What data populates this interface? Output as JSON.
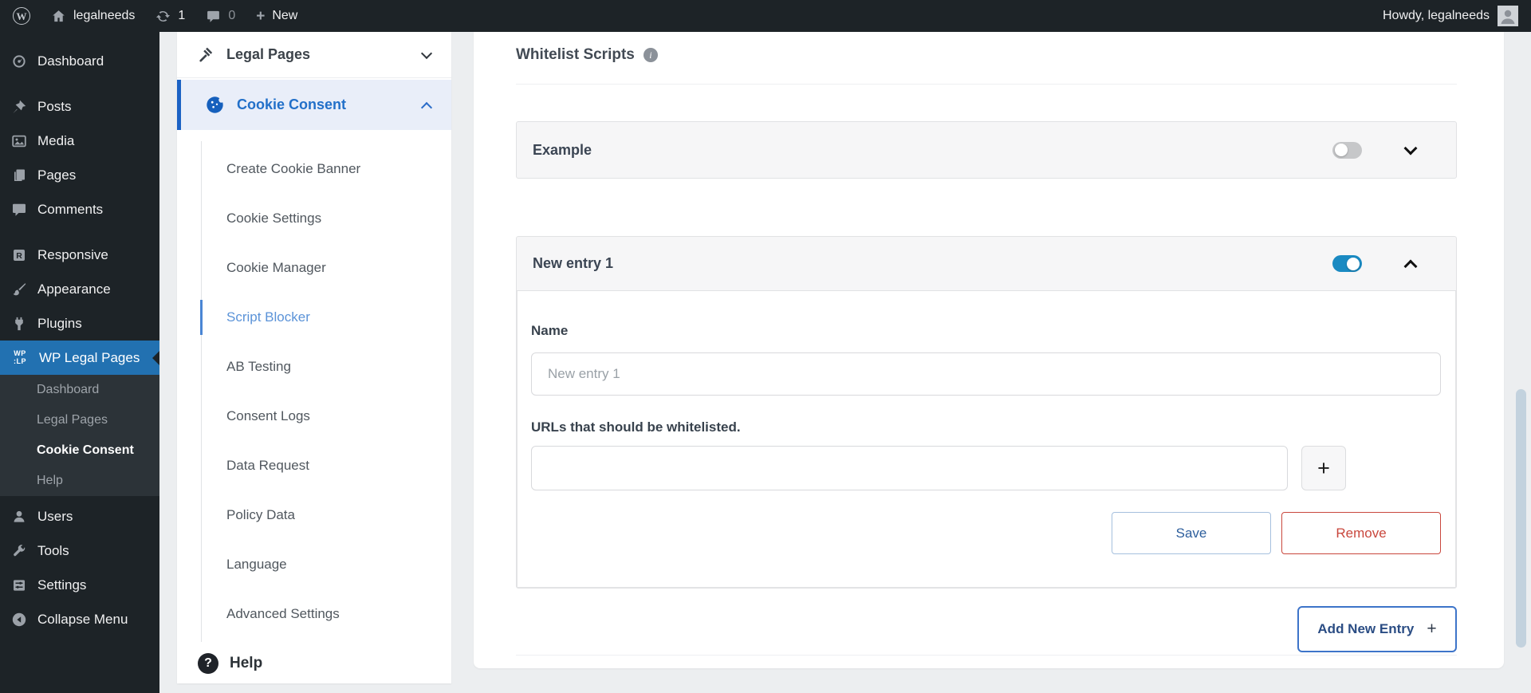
{
  "admin_bar": {
    "site_name": "legalneeds",
    "update_count": "1",
    "comment_count": "0",
    "new_label": "New",
    "howdy": "Howdy, legalneeds"
  },
  "admin_menu": {
    "items": [
      "Dashboard",
      "Posts",
      "Media",
      "Pages",
      "Comments",
      "Responsive",
      "Appearance",
      "Plugins",
      "WP Legal Pages"
    ],
    "logo_top": "WP",
    "logo_bottom": ":LP",
    "submenu": [
      "Dashboard",
      "Legal Pages",
      "Cookie Consent",
      "Help"
    ],
    "lower_items": [
      "Users",
      "Tools",
      "Settings",
      "Collapse Menu"
    ]
  },
  "plugin_sidebar": {
    "legal_pages_label": "Legal Pages",
    "cookie_consent_label": "Cookie Consent",
    "submenu": [
      "Create Cookie Banner",
      "Cookie Settings",
      "Cookie Manager",
      "Script Blocker",
      "AB Testing",
      "Consent Logs",
      "Data Request",
      "Policy Data",
      "Language",
      "Advanced Settings"
    ],
    "active_submenu_item": "Script Blocker",
    "help_label": "Help"
  },
  "main": {
    "heading": "Whitelist Scripts",
    "example_panel": {
      "title": "Example",
      "enabled": false
    },
    "entry_panel": {
      "title": "New entry 1",
      "enabled": true,
      "name_label": "Name",
      "name_placeholder": "New entry 1",
      "name_value": "",
      "urls_label": "URLs that should be whitelisted.",
      "url_value": "",
      "add_url_label": "+",
      "save_label": "Save",
      "remove_label": "Remove"
    },
    "add_new_label": "Add New Entry",
    "add_new_plus": "+"
  },
  "colors": {
    "accent_blue": "#2271b1",
    "toggle_on_blue": "#1a8ac2",
    "danger_red": "#c9473d",
    "active_link_blue": "#5b93d8"
  }
}
